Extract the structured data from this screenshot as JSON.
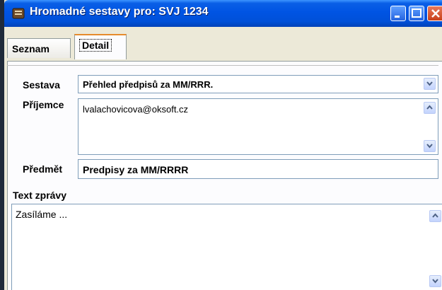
{
  "window": {
    "title": "Hromadné sestavy pro: SVJ 1234"
  },
  "tabs": [
    {
      "label": "Seznam"
    },
    {
      "label": "Detail"
    }
  ],
  "form": {
    "sestava_label": "Sestava",
    "sestava_value": "Přehled předpisů za MM/RRR.",
    "prijemce_label": "Příjemce",
    "prijemce_value": "lvalachovicova@oksoft.cz",
    "predmet_label": "Předmět",
    "predmet_value": "Predpisy za MM/RRRR",
    "text_label": "Text zprávy",
    "text_value": "Zasíláme ..."
  }
}
